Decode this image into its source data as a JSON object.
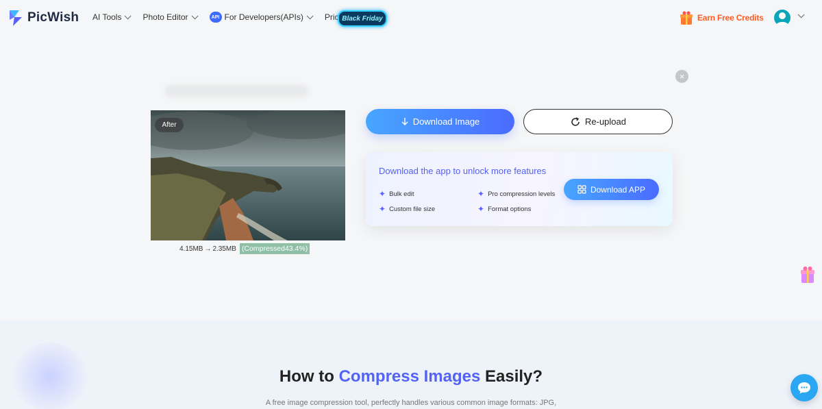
{
  "header": {
    "logo_text": "PicWish",
    "nav": {
      "ai_tools": "AI Tools",
      "photo_editor": "Photo Editor",
      "api_badge": "API",
      "developers": "For Developers(APIs)",
      "pricing": "Pricing",
      "black_friday": "Black Friday"
    },
    "earn_credits": "Earn Free Credits"
  },
  "result": {
    "after_tag": "After",
    "original_size": "4.15MB",
    "arrow": "→",
    "new_size": "2.35MB",
    "compressed_label": "(Compressed43.4%)"
  },
  "actions": {
    "download_label": "Download Image",
    "reupload_label": "Re-upload"
  },
  "promo": {
    "title": "Download the app to unlock more features",
    "features": [
      "Bulk edit",
      "Pro compression levels",
      "Custom file size",
      "Format options"
    ],
    "button_label": "Download APP"
  },
  "section": {
    "heading_prefix": "How to ",
    "heading_highlight": "Compress Images",
    "heading_suffix": " Easily?",
    "description": "A free image compression tool, perfectly handles various common image formats: JPG,"
  },
  "colors": {
    "accent": "#4a6bff",
    "highlight": "#5463f0",
    "earn": "#ff5a1f",
    "compressed_bg": "#8fbfa5"
  }
}
